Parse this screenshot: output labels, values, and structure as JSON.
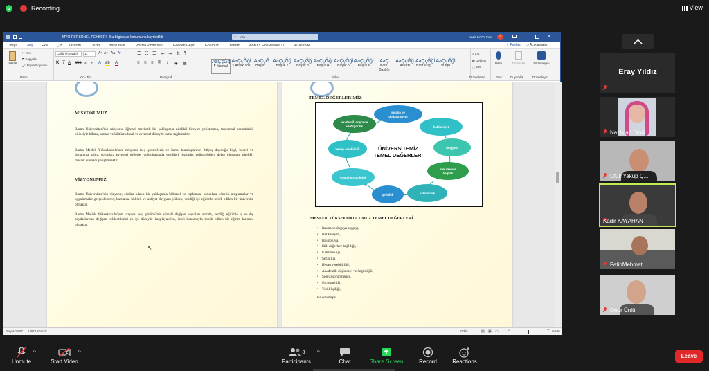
{
  "topbar": {
    "recording": "Recording",
    "view": "View"
  },
  "window": {
    "title": "MYO-PERSONEL REHBERİ - Bu bilgisayar konumuna kaydedildi",
    "search_placeholder": "Ara",
    "user": "Kadir KAYAHAN",
    "user_initials": "KK",
    "share": "Paylaş",
    "comments": "Açıklamalar"
  },
  "tabs": [
    "Dosya",
    "Giriş",
    "Ekle",
    "Çiz",
    "Tasarım",
    "Düzen",
    "Başvurular",
    "Posta Gönderileri",
    "Gözden Geçir",
    "Görünüm",
    "Yardım",
    "ABBYY FineReader 11",
    "ACROBAT"
  ],
  "ribbon": {
    "paste": "Yapıştır",
    "cut": "Kes",
    "copy": "Kopyala",
    "format_painter": "Biçim Boyacısı",
    "clipboard": "Pano",
    "font": "Calibri (Gövde)",
    "font_size": "11",
    "font_group": "Yazı Tipi",
    "paragraph_group": "Paragraf",
    "styles_group": "Stiller",
    "styles": [
      {
        "preview": "AaÇçĞğl",
        "name": "¶ Normal"
      },
      {
        "preview": "AaÇçĞğl",
        "name": "¶ Aralık Yok"
      },
      {
        "preview": "AaÇçĞ",
        "name": "Başlık 1"
      },
      {
        "preview": "AaÇçĞğ",
        "name": "Başlık 2"
      },
      {
        "preview": "AaÇçĞğ",
        "name": "Başlık 3"
      },
      {
        "preview": "AaÇçĞğl",
        "name": "Başlık 4"
      },
      {
        "preview": "AaÇçĞğl",
        "name": "Başlık 5"
      },
      {
        "preview": "AaÇçĞğl",
        "name": "Başlık 6"
      },
      {
        "preview": "AaÇ",
        "name": "Konu Başlığı"
      },
      {
        "preview": "AaÇçĞğ",
        "name": "Altyazı"
      },
      {
        "preview": "AaÇçĞğl",
        "name": "Hafif Vurg..."
      },
      {
        "preview": "AaÇçĞğl",
        "name": "Vurgu"
      }
    ],
    "find": "Ara",
    "replace": "Değiştir",
    "select": "Seç",
    "editing_group": "Düzenleme",
    "dictate": "Dikte",
    "voice_group": "Ses",
    "sensitivity": "Duyarlılık",
    "sensitivity_group": "Duyarlılık",
    "editor": "Düzenleyici",
    "editor_group": "Düzenleyici"
  },
  "page_left": {
    "h1": "MİSYONUMUZ",
    "p1": "Bartın Üniversitesi'nin misyonu; öğrenci merkezli bir yaklaşımla nitelikli bireyler yetiştirmek, toplumsal sorumluluk bilinciyle bilime, sanata ve kültüre ulusal ve evrensel düzeyde katkı sağlamaktır.",
    "p2": "Bartın Meslek Yüksekokulu'nun misyonu ise; işletmelerin ve kamu kuruluşlarının ihtiyaç duyduğu bilgi, beceri ve donanıma sahip, sorunlara evrensel değerler doğrultusunda yenilikçi çözümler geliştirebilen, değer oluşturan nitelikli meslek elemanı yetiştirmektir.",
    "h2": "VİZYONUMUZ",
    "p3": "Bartın Üniversitesi'nin vizyonu; çözüm odaklı bir yaklaşımla bilimsel ve toplumsal sorunlara yönelik araştırmalar ve uygulamalar gerçekleştiren, kurumsal kültürü ve aidiyet duygusu yüksek, verdiği iyi eğitimle tercih edilen bir üniversite olmaktır.",
    "p4": "Bartın Meslek Yüksekokulu'nun vizyonu ise; günümüzün sürekli değişen koşulları altında, verdiği eğitimle iç ve dış paydaşlarının değişen beklentilerini en iyi düzeyde karşılayabilen, öncü konumuyla tercih edilen bir eğitim kurumu olmaktır."
  },
  "page_right": {
    "h1": "TEMEL DEĞERLERİMİZ",
    "diagram_title": "ÜNİVERSİTEMİZ\nTEMEL DEĞERLERİ",
    "diagram_items": [
      "insana ve doğaya saygı",
      "hakkaniyet",
      "hoşgörü",
      "etik ilkelere bağlılık",
      "katılımcılık",
      "şeffaflık",
      "sosyal sorumluluk",
      "hesap verebilirlik",
      "akademik düşünce ve özgürlük"
    ],
    "h2": "MESLEK YÜKSEKOKULUMUZ TEMEL DEĞERLERİ",
    "bullets": [
      "İnsana ve doğaya saygıyı,",
      "Hakkaniyeti,",
      "Hoşgörüyü,",
      "Etik değerlere bağlılığı,",
      "Katılımcılığı,",
      "Şeffaflığı,",
      "Hesap verebilirliği,",
      "Akademik düşünceyi ve özgürlüğü,",
      "Sosyal sorumluluğu,",
      "Girişimciliği,",
      "Yenilikçiliği,"
    ],
    "closing": "ilke edinmiştir."
  },
  "status": {
    "page": "Sayfa 13/97",
    "words": "14814 sözcük",
    "focus": "Odak",
    "zoom": "%100"
  },
  "participants": [
    {
      "name": "Eray Yıldız"
    },
    {
      "name": "Nazlıcan Dind..."
    },
    {
      "name": "Ufuk Yakup Ç..."
    },
    {
      "name": "Kadir KAYAHAN"
    },
    {
      "name": "FatihMehmet ..."
    },
    {
      "name": "Onur Ünlü"
    }
  ],
  "toolbar": {
    "unmute": "Unmute",
    "start_video": "Start Video",
    "participants": "Participants",
    "participants_count": "8",
    "chat": "Chat",
    "share_screen": "Share Screen",
    "record": "Record",
    "reactions": "Reactions",
    "leave": "Leave"
  },
  "colors": {
    "accent_green": "#23d959",
    "leave_red": "#e02828",
    "word_blue": "#2b579a",
    "active_speaker": "#c5e85a"
  }
}
